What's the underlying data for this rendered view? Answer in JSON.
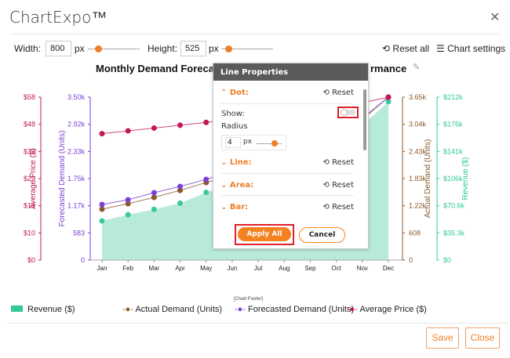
{
  "app": {
    "title": "ChartExpo™",
    "close_icon": "close-icon"
  },
  "toolbar": {
    "width_label": "Width:",
    "width_value": "800",
    "height_label": "Height:",
    "height_value": "525",
    "unit": "px",
    "reset_all": "Reset all",
    "chart_settings": "Chart settings",
    "width_slider_fraction": 0.25,
    "height_slider_fraction": 0.15
  },
  "chart_title": {
    "left": "Monthly Demand Foreca",
    "right": "rmance"
  },
  "chart_data": {
    "type": "combo",
    "categories": [
      "Jan",
      "Feb",
      "Mar",
      "Apr",
      "May",
      "Jun",
      "Jul",
      "Aug",
      "Sep",
      "Oct",
      "Nov",
      "Dec"
    ],
    "axes": {
      "price": {
        "label": "Average Price ($)",
        "ticks": [
          "$0",
          "$10",
          "$19",
          "$29",
          "$39",
          "$48",
          "$58"
        ],
        "range": [
          0,
          58
        ],
        "color": "#c2185b"
      },
      "forecast": {
        "label": "Forecasted Demand (Units)",
        "ticks": [
          "0",
          "583",
          "1.17k",
          "1.75k",
          "2.33k",
          "2.92k",
          "3.50k"
        ],
        "range": [
          0,
          3500
        ],
        "color": "#7b3fd6"
      },
      "actual": {
        "label": "Actual Demand (Units)",
        "ticks": [
          "0",
          "608",
          "1.22k",
          "1.83k",
          "2.43k",
          "3.04k",
          "3.65k"
        ],
        "range": [
          0,
          3650
        ],
        "color": "#8b5a2b"
      },
      "revenue": {
        "label": "Revenue ($)",
        "ticks": [
          "$0",
          "$35.3k",
          "$70.6k",
          "$106k",
          "$141k",
          "$176k",
          "$212k"
        ],
        "range": [
          0,
          212000
        ],
        "color": "#2ec99a"
      }
    },
    "series": [
      {
        "name": "Revenue ($)",
        "type": "area",
        "axis": "revenue",
        "color": "#b8eadb",
        "dot": "#3cc99c",
        "values": [
          51000,
          59000,
          66000,
          74000,
          88000,
          98000,
          110000,
          122000,
          135000,
          150000,
          175000,
          206000
        ]
      },
      {
        "name": "Actual Demand (Units)",
        "type": "line",
        "axis": "actual",
        "color": "#8b5a2b",
        "values": [
          1140,
          1263,
          1404,
          1562,
          1737,
          1900,
          2080,
          2300,
          2520,
          2800,
          3150,
          3650
        ]
      },
      {
        "name": "Forecasted Demand (Units)",
        "type": "line",
        "axis": "forecast",
        "color": "#7b3fd6",
        "values": [
          1195,
          1296,
          1447,
          1582,
          1733,
          1900,
          2080,
          2280,
          2500,
          2750,
          3050,
          3500
        ]
      },
      {
        "name": "Average Price ($)",
        "type": "line",
        "axis": "price",
        "color": "#c2185b",
        "values": [
          45,
          46,
          47,
          48,
          49,
          50,
          51,
          52,
          54,
          55,
          56,
          58
        ]
      }
    ],
    "legend_position": "bottom"
  },
  "legend": {
    "footer": "[Chart Footer]",
    "items": [
      "Revenue ($)",
      "Actual Demand (Units)",
      "Forecasted Demand (Units)",
      "Average Price ($)"
    ]
  },
  "panel": {
    "title": "Line Properties",
    "dot": "Dot:",
    "reset": "Reset",
    "show": "Show:",
    "show_on": false,
    "radius": "Radius",
    "radius_value": "4",
    "unit": "px",
    "line": "Line:",
    "area": "Area:",
    "bar": "Bar:",
    "apply": "Apply All",
    "cancel": "Cancel"
  },
  "footer": {
    "save": "Save",
    "close": "Close"
  }
}
